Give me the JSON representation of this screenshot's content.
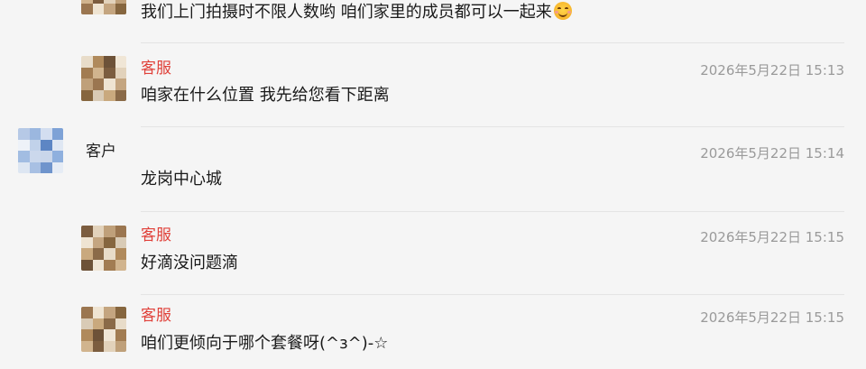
{
  "messages": [
    {
      "sender": "",
      "role": "agent",
      "time": "",
      "text": "我们上门拍摄时不限人数哟 咱们家里的成员都可以一起来",
      "emoji": "smiling-face-icon"
    },
    {
      "sender": "客服",
      "role": "agent",
      "time": "2026年5月22日  15:13",
      "text": "咱家在什么位置 我先给您看下距离"
    },
    {
      "sender": "客户",
      "role": "customer",
      "time": "2026年5月22日  15:14",
      "text": "龙岗中心城"
    },
    {
      "sender": "客服",
      "role": "agent",
      "time": "2026年5月22日  15:15",
      "text": "好滴没问题滴"
    },
    {
      "sender": "客服",
      "role": "agent",
      "time": "2026年5月22日  15:15",
      "text": "咱们更倾向于哪个套餐呀(^з^)-☆"
    }
  ],
  "colors": {
    "background": "#f5f5f5",
    "agent_name": "#e0413a",
    "customer_name": "#222222",
    "timestamp": "#9a9a9a",
    "divider": "#e4e4e4"
  }
}
